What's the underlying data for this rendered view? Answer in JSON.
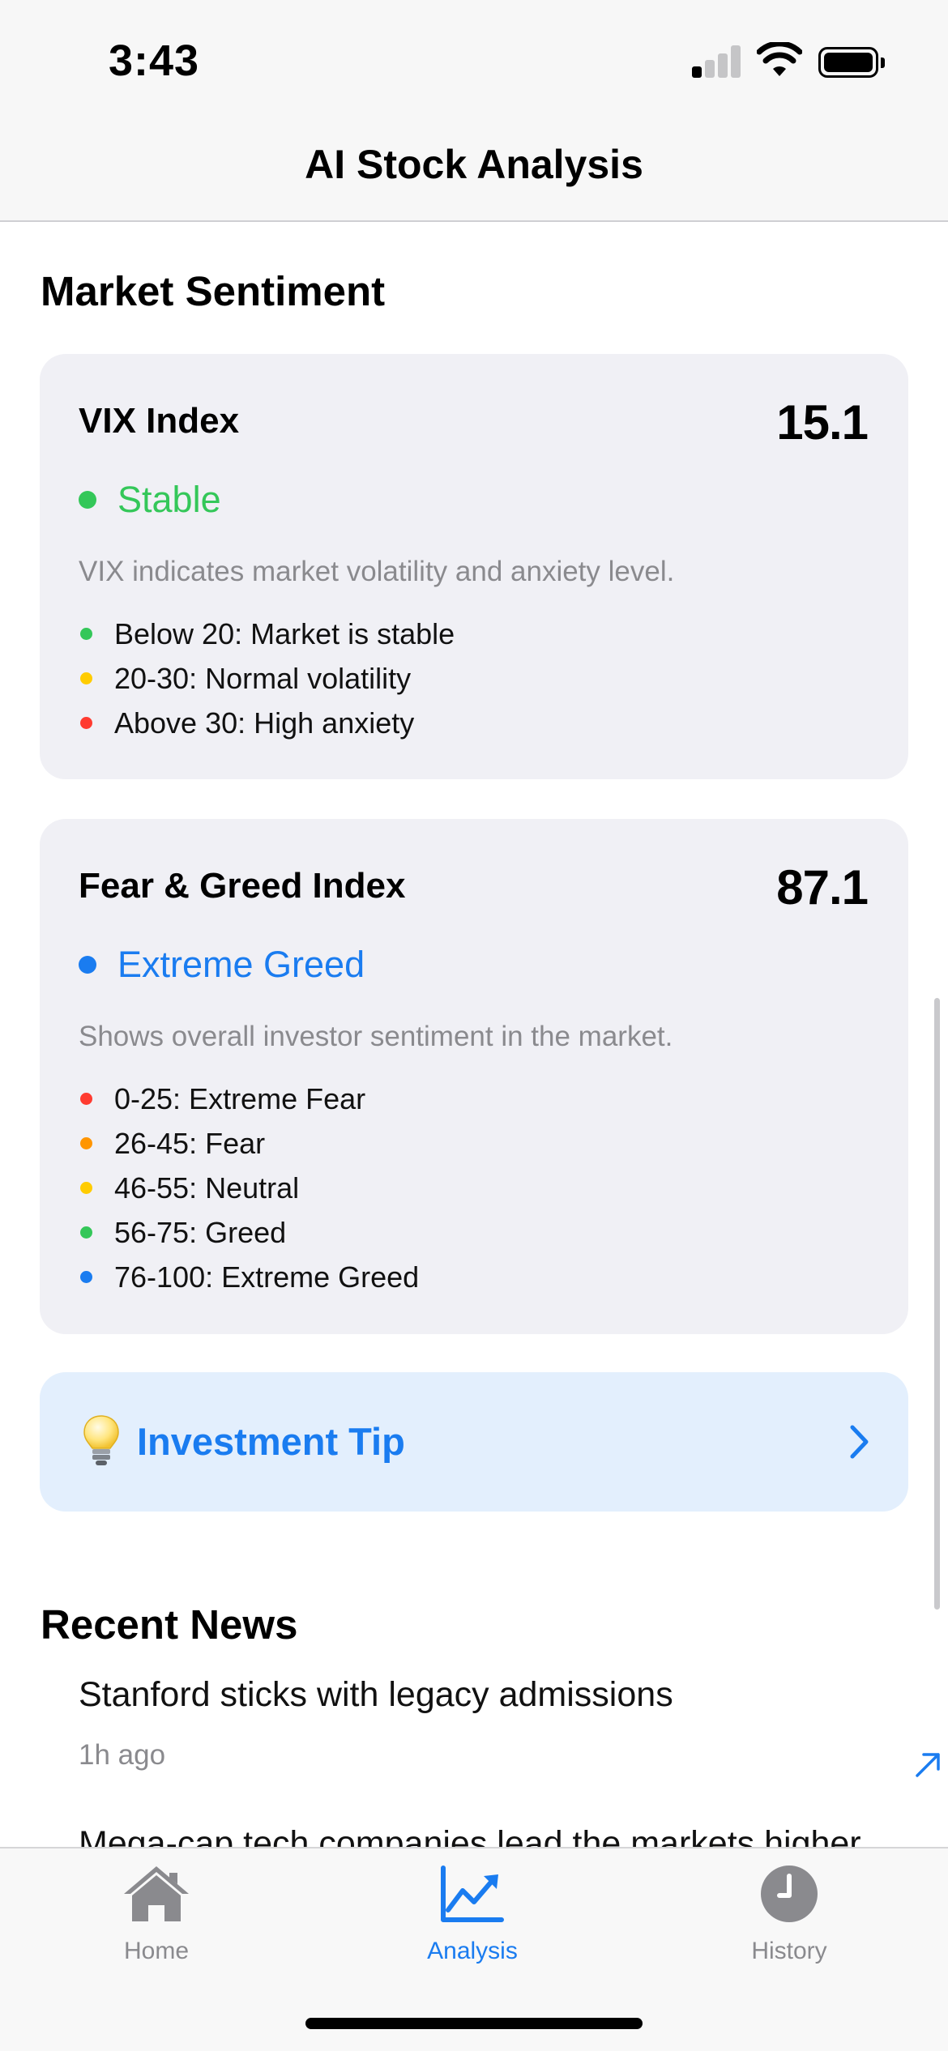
{
  "status_bar": {
    "time": "3:43"
  },
  "nav": {
    "title": "AI Stock Analysis"
  },
  "market_sentiment": {
    "heading": "Market Sentiment",
    "vix": {
      "title": "VIX Index",
      "value": "15.1",
      "status": "Stable",
      "status_color": "#34c759",
      "description": "VIX indicates market volatility and anxiety level.",
      "legend": [
        {
          "label": "Below 20: Market is stable",
          "color": "#34c759"
        },
        {
          "label": "20-30: Normal volatility",
          "color": "#ffcc00"
        },
        {
          "label": "Above 30: High anxiety",
          "color": "#ff3b30"
        }
      ]
    },
    "fear_greed": {
      "title": "Fear & Greed Index",
      "value": "87.1",
      "status": "Extreme Greed",
      "status_color": "#1a7cf0",
      "description": "Shows overall investor sentiment in the market.",
      "legend": [
        {
          "label": "0-25: Extreme Fear",
          "color": "#ff3b30"
        },
        {
          "label": "26-45: Fear",
          "color": "#ff9500"
        },
        {
          "label": "46-55: Neutral",
          "color": "#ffcc00"
        },
        {
          "label": "56-75: Greed",
          "color": "#34c759"
        },
        {
          "label": "76-100: Extreme Greed",
          "color": "#1a7cf0"
        }
      ]
    }
  },
  "investment_tip": {
    "label": "Investment Tip",
    "icon": "lightbulb-icon"
  },
  "recent_news": {
    "heading": "Recent News",
    "items": [
      {
        "headline": "Stanford sticks with legacy admissions",
        "time": "1h ago"
      },
      {
        "headline": "Mega-cap tech companies lead the markets higher",
        "time": ""
      }
    ]
  },
  "tab_bar": {
    "tabs": [
      {
        "label": "Home",
        "icon": "house-icon",
        "active": false
      },
      {
        "label": "Analysis",
        "icon": "chart-line-icon",
        "active": true
      },
      {
        "label": "History",
        "icon": "clock-icon",
        "active": false
      }
    ],
    "active_color": "#1a7cf0",
    "inactive_color": "#8a8a8e"
  },
  "colors": {
    "accent": "#1a7cf0",
    "card_background": "#f0f0f5",
    "tip_background": "#e3effd"
  }
}
